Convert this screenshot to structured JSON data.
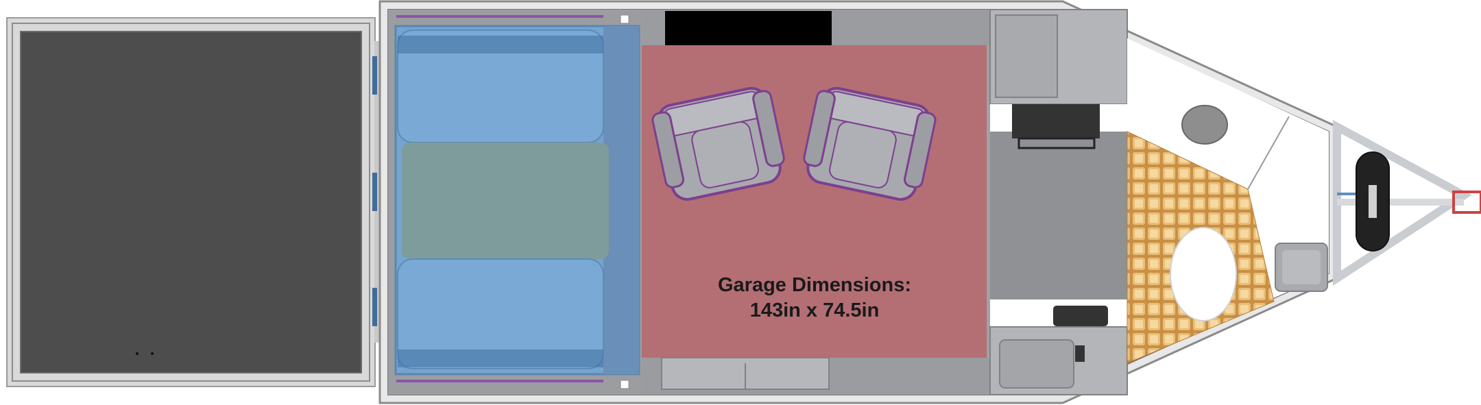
{
  "garage_label": {
    "line1": "Garage Dimensions:",
    "line2": "143in x 74.5in"
  },
  "colors": {
    "ramp_door": "#4d4d4d",
    "garage_floor": "#b36f74",
    "sofa_blue": "#74a4cf",
    "sofa_teal": "#7e9c9c",
    "floor_gray": "#8f9194",
    "cabinet_gray": "#aeb0b3",
    "chair_gray": "#a7a9ae",
    "chair_outline": "#7d3f8f",
    "tile_gold": "#d9a85c",
    "dark_appliance": "#333333"
  },
  "icons": {
    "coupler": "hitch-coupler-icon",
    "jack": "tongue-jack-icon"
  }
}
